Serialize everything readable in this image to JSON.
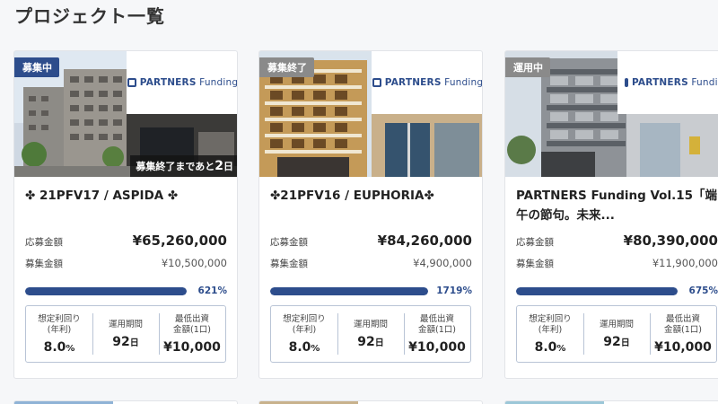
{
  "page": {
    "title": "プロジェクト一覧"
  },
  "cards": [
    {
      "status": "募集中",
      "status_color": "#2d4d8c",
      "countdown_prefix": "募集終了まであと",
      "countdown_days": "2",
      "countdown_suffix": "日",
      "logo": {
        "brand": "PARTNERS",
        "sub": "Funding"
      },
      "title": "✤ 21PFV17 / ASPIDA ✤",
      "applied_label": "応募金額",
      "applied_value": "¥65,260,000",
      "target_label": "募集金額",
      "target_value": "¥10,500,000",
      "progress_text": "621%",
      "progress_fraction": 1.0,
      "stats": {
        "yield_label": "想定利回り\n(年利)",
        "yield_value": "8.0",
        "yield_unit": "%",
        "period_label": "運用期間",
        "period_value": "92",
        "period_unit": "日",
        "min_label": "最低出資\n金額(1口)",
        "min_value": "¥10,000"
      }
    },
    {
      "status": "募集終了",
      "status_color": "#8a8a8a",
      "logo": {
        "brand": "PARTNERS",
        "sub": "Funding"
      },
      "title": "✤21PFV16 / EUPHORIA✤",
      "applied_label": "応募金額",
      "applied_value": "¥84,260,000",
      "target_label": "募集金額",
      "target_value": "¥4,900,000",
      "progress_text": "1719%",
      "progress_fraction": 1.0,
      "stats": {
        "yield_label": "想定利回り\n(年利)",
        "yield_value": "8.0",
        "yield_unit": "%",
        "period_label": "運用期間",
        "period_value": "92",
        "period_unit": "日",
        "min_label": "最低出資\n金額(1口)",
        "min_value": "¥10,000"
      }
    },
    {
      "status": "運用中",
      "status_color": "#8a8a8a",
      "logo": {
        "brand": "PARTNERS",
        "sub": "Funding"
      },
      "title": "PARTNERS Funding Vol.15「端午の節句。未来...",
      "applied_label": "応募金額",
      "applied_value": "¥80,390,000",
      "target_label": "募集金額",
      "target_value": "¥11,900,000",
      "progress_text": "675%",
      "progress_fraction": 1.0,
      "stats": {
        "yield_label": "想定利回り\n(年利)",
        "yield_value": "8.0",
        "yield_unit": "%",
        "period_label": "運用期間",
        "period_value": "92",
        "period_unit": "日",
        "min_label": "最低出資\n金額(1口)",
        "min_value": "¥10,000"
      }
    }
  ]
}
